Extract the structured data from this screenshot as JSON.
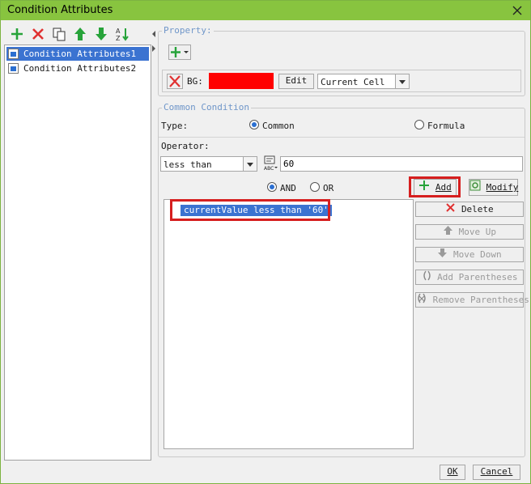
{
  "window": {
    "title": "Condition Attributes"
  },
  "tree": {
    "items": [
      {
        "label": "Condition Attributes1",
        "selected": true
      },
      {
        "label": "Condition Attributes2",
        "selected": false
      }
    ]
  },
  "property": {
    "legend": "Property:",
    "bg_label": "BG:",
    "bg_color": "#ff0000",
    "edit_label": "Edit",
    "scope_value": "Current Cell"
  },
  "common_condition": {
    "legend": "Common Condition",
    "type_label": "Type:",
    "type_common": "Common",
    "type_formula": "Formula",
    "operator_label": "Operator:",
    "operator_value": "less than",
    "value_input": "60",
    "and_label": "AND",
    "or_label": "OR",
    "add_label": "Add",
    "modify_label": "Modify"
  },
  "conditions": [
    "currentValue less than '60'"
  ],
  "side_buttons": {
    "delete": "Delete",
    "move_up": "Move Up",
    "move_down": "Move Down",
    "add_parentheses": "Add Parentheses",
    "remove_parentheses": "Remove Parentheses"
  },
  "footer": {
    "ok": "OK",
    "cancel": "Cancel"
  },
  "colors": {
    "titlebar": "#88c43f",
    "selection": "#3b73d1",
    "highlight": "#d61f1f",
    "legend": "#6f96c9"
  }
}
